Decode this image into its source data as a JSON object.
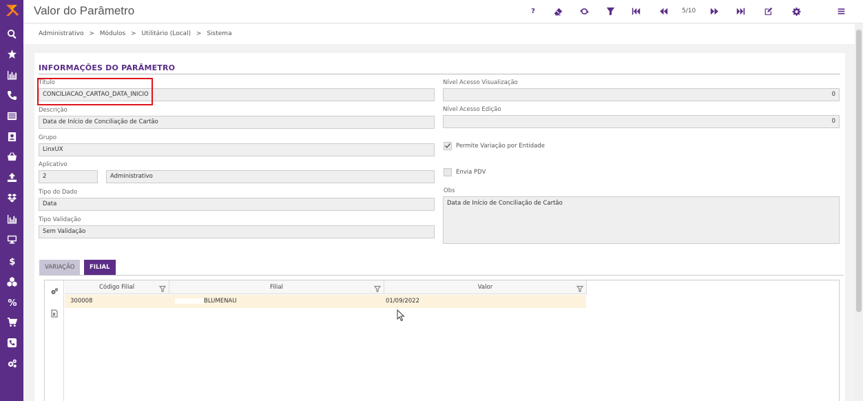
{
  "app": {
    "title": "Valor do Parâmetro",
    "brand_color": "#5b2d86",
    "highlight_color": "#e0131a"
  },
  "sidebar": {
    "items": [
      {
        "icon": "search-icon"
      },
      {
        "icon": "star-icon"
      },
      {
        "icon": "bar-chart-icon"
      },
      {
        "icon": "phone-icon"
      },
      {
        "icon": "list-icon"
      },
      {
        "icon": "contact-card-icon"
      },
      {
        "icon": "basket-icon"
      },
      {
        "icon": "upload-icon"
      },
      {
        "icon": "dropbox-icon"
      },
      {
        "icon": "bar-chart-icon"
      },
      {
        "icon": "monitor-icon"
      },
      {
        "icon": "dollar-icon"
      },
      {
        "icon": "boxes-icon"
      },
      {
        "icon": "percent-icon"
      },
      {
        "icon": "cart-icon"
      },
      {
        "icon": "phone-square-icon"
      },
      {
        "icon": "cogs-icon"
      }
    ]
  },
  "toolbar": {
    "help_label": "?",
    "counter": "5/10",
    "icons": [
      "help-icon",
      "eraser-icon",
      "refresh-icon",
      "filter-icon",
      "first-record-icon",
      "previous-record-icon",
      "next-record-icon",
      "last-record-icon",
      "edit-icon",
      "settings-icon",
      "menu-icon"
    ]
  },
  "breadcrumb": {
    "items": [
      "Administrativo",
      ">",
      "Módulos",
      ">",
      "Utilitário (Local)",
      ">",
      "Sistema"
    ]
  },
  "form": {
    "section_title": "INFORMAÇÕES DO PARÂMETRO",
    "titulo_label": "Título",
    "titulo_value": "CONCILIACAO_CARTAO_DATA_INICIO",
    "descricao_label": "Descrição",
    "descricao_value": "Data de Início de Conciliação de Cartão",
    "grupo_label": "Grupo",
    "grupo_value": "LinxUX",
    "aplicativo_label": "Aplicativo",
    "aplicativo_code": "2",
    "aplicativo_name": "Administrativo",
    "tipo_dado_label": "Tipo do Dado",
    "tipo_dado_value": "Data",
    "tipo_validacao_label": "Tipo Validação",
    "tipo_validacao_value": "Sem Validação",
    "nivel_visualizacao_label": "Nível Acesso Visualização",
    "nivel_visualizacao_value": "0",
    "nivel_edicao_label": "Nível Acesso Edição",
    "nivel_edicao_value": "0",
    "permite_variacao_label": "Permite Variação por Entidade",
    "permite_variacao_checked": true,
    "envia_pdv_label": "Envia PDV",
    "envia_pdv_checked": false,
    "obs_label": "Obs",
    "obs_value": "Data de Início de Conciliação de Cartão"
  },
  "tabs": [
    {
      "label": "VARIAÇÃO",
      "active": false
    },
    {
      "label": "FILIAL",
      "active": true
    }
  ],
  "grid": {
    "columns": [
      "Código Filial",
      "Filial",
      "Valor"
    ],
    "rows": [
      {
        "codigo": "300008",
        "filial": "BLUMENAU",
        "valor": "01/09/2022"
      }
    ],
    "tool_icons": [
      "grid-settings-icon",
      "export-excel-icon"
    ]
  }
}
